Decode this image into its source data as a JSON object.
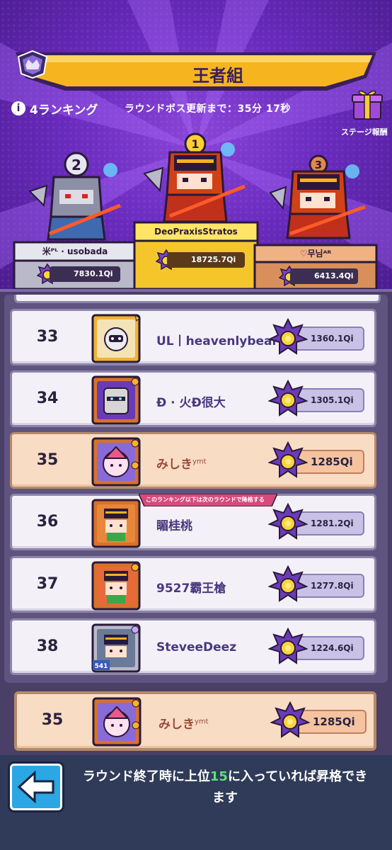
{
  "header": {
    "league_title": "王者組",
    "ranking_label": "4ランキング",
    "boss_update_text": "ラウンドボス更新まで：35分 17秒",
    "stage_reward_label": "ステージ報酬"
  },
  "podium": [
    {
      "place": "2",
      "name": "米ᴾᴸ · usobada",
      "score": "7830.1Qi",
      "color": "#b9b9c9"
    },
    {
      "place": "1",
      "name": "DeoPraxisStratos",
      "score": "18725.7Qi",
      "color": "#f4c62c"
    },
    {
      "place": "3",
      "name": "♡무님ᴬᴿ",
      "score": "6413.4Qi",
      "color": "#d98f5a"
    }
  ],
  "rows": [
    {
      "rank": "33",
      "name": "UL丨heavenlybear",
      "score": "1360.1Qi",
      "highlight": false
    },
    {
      "rank": "34",
      "name": "Đ · 火Đ很大",
      "score": "1305.1Qi",
      "highlight": false
    },
    {
      "rank": "35",
      "name": "みしき",
      "name_sup": "ymt",
      "score": "1285Qi",
      "highlight": true
    },
    {
      "rank": "36",
      "name": "睸桂桃",
      "score": "1281.2Qi",
      "highlight": false
    },
    {
      "rank": "37",
      "name": "9527霸王槍",
      "score": "1277.8Qi",
      "highlight": false
    },
    {
      "rank": "38",
      "name": "SteveeDeez",
      "score": "1224.6Qi",
      "highlight": false
    }
  ],
  "demote_notice": "このランキング以下は次のラウンドで降格する",
  "my_row": {
    "rank": "35",
    "name": "みしき",
    "name_sup": "ymt",
    "score": "1285Qi"
  },
  "level_badge": "541",
  "footer": {
    "hint_part1": "ラウンド終了時に上位",
    "hint_num": "15",
    "hint_part2": "に入っていれば昇格できます"
  },
  "icons": [
    "back-arrow-icon",
    "gift-icon",
    "info-icon",
    "crown-crest-icon",
    "qi-coin-icon"
  ]
}
